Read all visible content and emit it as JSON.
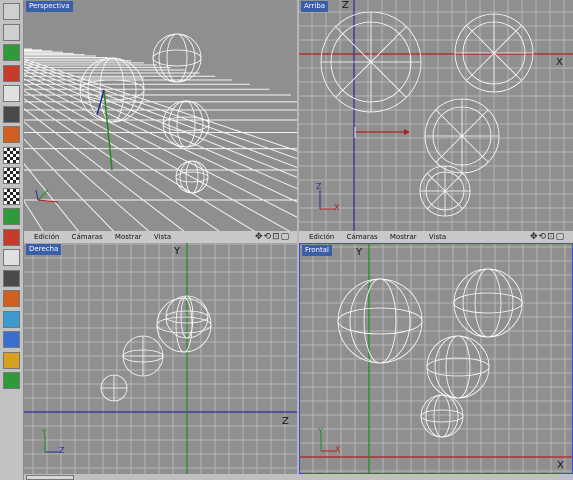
{
  "menus": [
    "Edición",
    "Cámaras",
    "Mostrar",
    "Vista"
  ],
  "nav_icons": "✥⟲⊡▢",
  "viewports": {
    "perspective": {
      "label": "Perspectiva"
    },
    "top": {
      "label": "Arriba",
      "axis_x": "X",
      "axis_z": "Z"
    },
    "right": {
      "label": "Derecha",
      "axis_y": "Y",
      "axis_z": "Z"
    },
    "front": {
      "label": "Frontal",
      "axis_y": "Y",
      "axis_x": "X"
    }
  },
  "colors": {
    "viewport_bg": "#8f8f8f",
    "label_bg": "#3b5ea8",
    "x_axis": "#b02020",
    "y_axis": "#1e8c1e",
    "z_axis": "#2a2a9a",
    "wire": "#ffffff",
    "active_border": "#3a4fcf"
  },
  "toolbar_icons": [
    "undo-icon",
    "redo-icon",
    "cube-icon",
    "axis-icon",
    "points-icon",
    "edges-icon",
    "polygons-icon",
    "checker-icon",
    "checker2-icon",
    "checker3-icon",
    "move-icon",
    "scale-icon",
    "rotate-icon",
    "snap-icon",
    "magnet-icon",
    "brush-icon",
    "paint-icon",
    "knife-icon",
    "extrude-icon"
  ]
}
